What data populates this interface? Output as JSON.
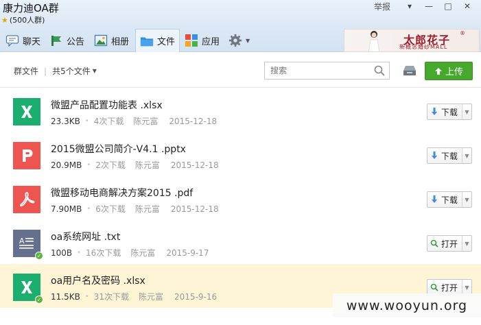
{
  "window": {
    "title": "康力迪OA群",
    "member_count": "(500人群)",
    "report_label": "举报",
    "controls": [
      "▾",
      "—",
      "□",
      "✕"
    ]
  },
  "tabs": [
    {
      "label": "聊天",
      "icon": "chat-icon"
    },
    {
      "label": "公告",
      "icon": "announcement-icon"
    },
    {
      "label": "相册",
      "icon": "album-icon"
    },
    {
      "label": "文件",
      "icon": "folder-icon",
      "active": true
    },
    {
      "label": "应用",
      "icon": "apps-icon"
    },
    {
      "label": "",
      "icon": "gear-icon"
    }
  ],
  "banner": {
    "brand": "太郎花子",
    "registered": "®",
    "tagline": "新概念婚纱MALL"
  },
  "toolbar": {
    "group_files_label": "群文件",
    "separator": "|",
    "file_count_label": "共5个文件",
    "search_placeholder": "搜索",
    "upload_label": "上传"
  },
  "files": [
    {
      "name": "微盟产品配置功能表 .xlsx",
      "type": "xlsx",
      "letter": "X",
      "color": "#1aae6f",
      "size": "23.3KB",
      "downloads": "4次下载",
      "uploader": "陈元富",
      "date": "2015-12-18",
      "action": "下载",
      "synced": false
    },
    {
      "name": "2015微盟公司简介-V4.1 .pptx",
      "type": "pptx",
      "letter": "P",
      "color": "#ef5550",
      "size": "20.9MB",
      "downloads": "2次下载",
      "uploader": "陈元富",
      "date": "2015-12-18",
      "action": "下载",
      "synced": false
    },
    {
      "name": "微盟移动电商解决方案2015 .pdf",
      "type": "pdf",
      "letter": "",
      "color": "#ef5550",
      "size": "7.90MB",
      "downloads": "6次下载",
      "uploader": "陈元富",
      "date": "2015-12-18",
      "action": "下载",
      "synced": false
    },
    {
      "name": "oa系统网址 .txt",
      "type": "txt",
      "letter": "",
      "color": "#65708f",
      "size": "100B",
      "downloads": "16次下载",
      "uploader": "陈元富",
      "date": "2015-9-17",
      "action": "打开",
      "synced": true
    },
    {
      "name": "oa用户名及密码 .xlsx",
      "type": "xlsx",
      "letter": "X",
      "color": "#1aae6f",
      "size": "11.5KB",
      "downloads": "31次下载",
      "uploader": "陈元富",
      "date": "2015-9-16",
      "action": "打开",
      "synced": true
    }
  ],
  "watermark": "www.wooyun.org"
}
